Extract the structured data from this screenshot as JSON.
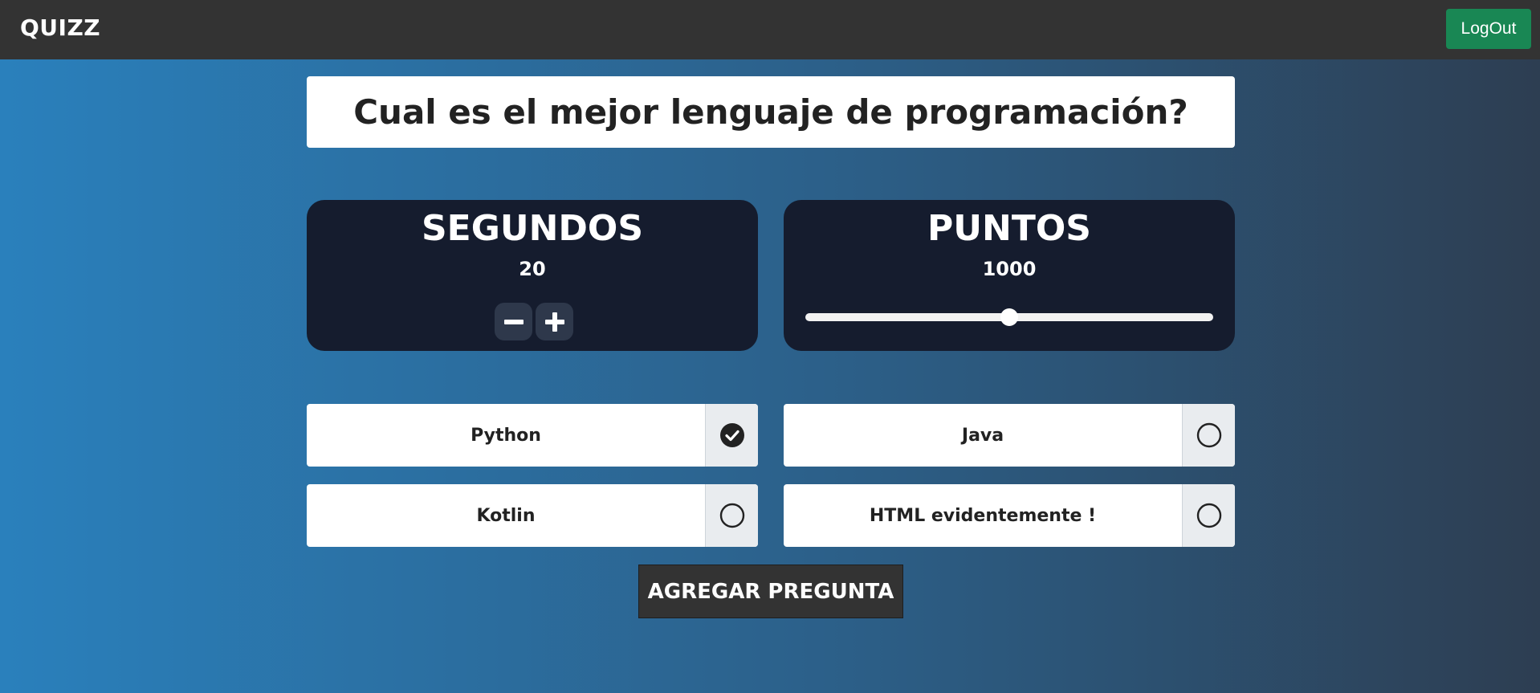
{
  "navbar": {
    "brand": "QUIZZ",
    "logout_label": "LogOut"
  },
  "question": {
    "text": "Cual es el mejor lenguaje de programación?"
  },
  "time_panel": {
    "title": "SEGUNDOS",
    "value": "20",
    "decrement_icon": "minus-icon",
    "increment_icon": "plus-icon"
  },
  "points_panel": {
    "title": "PUNTOS",
    "value": "1000",
    "slider_fraction": 0.5
  },
  "answers": [
    {
      "label": "Python",
      "selected": true
    },
    {
      "label": "Java",
      "selected": false
    },
    {
      "label": "Kotlin",
      "selected": false
    },
    {
      "label": "HTML evidentemente !",
      "selected": false
    }
  ],
  "add_button_label": "AGREGAR PREGUNTA",
  "colors": {
    "navbar": "#333333",
    "logout": "#198754",
    "panel": "#151c2e",
    "gradient_start": "#2a80bc",
    "gradient_end": "#2d3e52"
  }
}
